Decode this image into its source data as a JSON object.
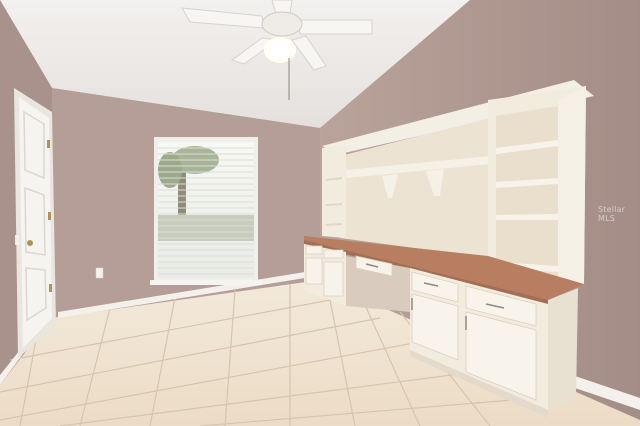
{
  "photo": {
    "scene": "empty-home-office-room",
    "watermark_text": "Stellar MLS"
  },
  "colors": {
    "wall": "#b59e97",
    "wall_shadow": "#9d8680",
    "ceiling": "#ece9e7",
    "floor_tile": "#efe3d2",
    "grout": "#d8c8b3",
    "cabinet": "#f2ecdf",
    "counter": "#b77e62",
    "trim": "#f4f1ec"
  }
}
